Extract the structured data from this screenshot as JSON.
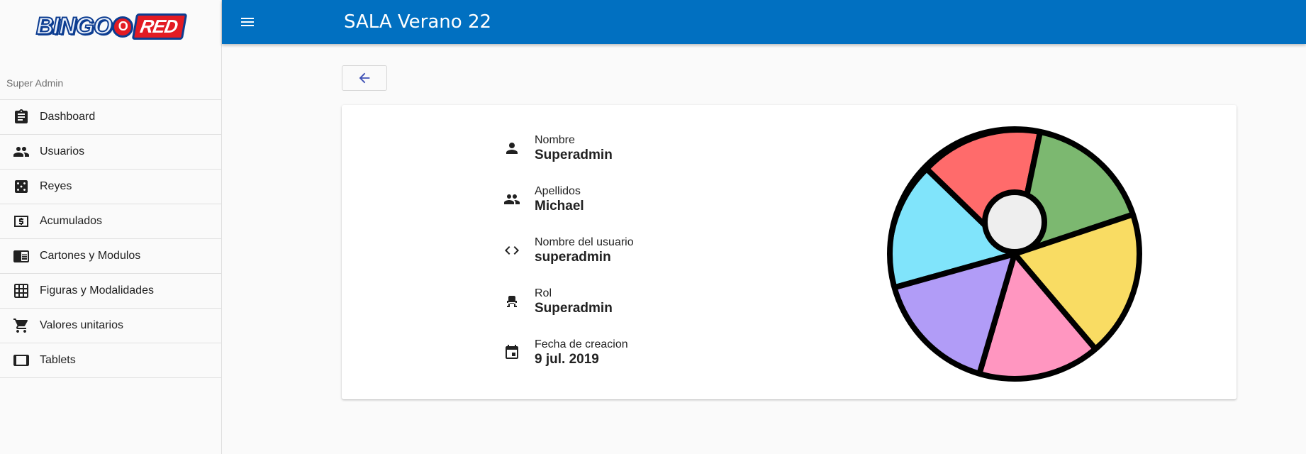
{
  "app": {
    "logo_text": "BINGO RED",
    "page_title": "SALA Verano 22"
  },
  "sidebar": {
    "role_label": "Super Admin",
    "items": [
      {
        "label": "Dashboard",
        "icon": "clipboard-icon"
      },
      {
        "label": "Usuarios",
        "icon": "people-icon"
      },
      {
        "label": "Reyes",
        "icon": "dice-icon"
      },
      {
        "label": "Acumulados",
        "icon": "money-icon"
      },
      {
        "label": "Cartones y Modulos",
        "icon": "chrome-reader-icon"
      },
      {
        "label": "Figuras y Modalidades",
        "icon": "grid-icon"
      },
      {
        "label": "Valores unitarios",
        "icon": "cart-icon"
      },
      {
        "label": "Tablets",
        "icon": "tablet-icon"
      }
    ]
  },
  "profile": {
    "fields": [
      {
        "label": "Nombre",
        "value": "Superadmin",
        "icon": "person-icon"
      },
      {
        "label": "Apellidos",
        "value": "Michael",
        "icon": "people-icon"
      },
      {
        "label": "Nombre del usuario",
        "value": "superadmin",
        "icon": "code-icon"
      },
      {
        "label": "Rol",
        "value": "Superadmin",
        "icon": "seat-icon"
      },
      {
        "label": "Fecha de creacion",
        "value": "9 jul. 2019",
        "icon": "calendar-icon"
      }
    ]
  },
  "colors": {
    "topbar": "#0170c1",
    "ball_red": "#ff6b6b",
    "ball_green": "#7cb870",
    "ball_yellow": "#f9dc63",
    "ball_pink": "#ff96c0",
    "ball_purple": "#b19cf7",
    "ball_cyan": "#80e4fb"
  }
}
